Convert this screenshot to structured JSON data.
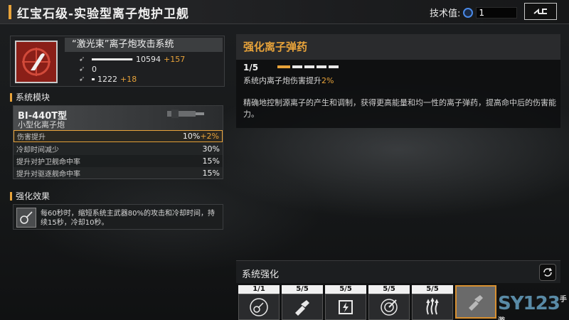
{
  "header": {
    "title": "红宝石级-实验型离子炮护卫舰",
    "tech_label": "技术值:",
    "tech_value": "1"
  },
  "weapon": {
    "name": "“激光束”离子炮攻击系统",
    "stats": [
      {
        "icon": "damage-icon",
        "value": "10594",
        "bonus": "+157",
        "fill": 0.98
      },
      {
        "icon": "rate-icon",
        "value": "0",
        "bonus": "",
        "fill": 0
      },
      {
        "icon": "range-icon",
        "value": "1222",
        "bonus": "+18",
        "fill": 0.05
      }
    ]
  },
  "module": {
    "section_label": "系统模块",
    "code": "BI-440T型",
    "type": "小型化离子炮",
    "rows": [
      {
        "label": "伤害提升",
        "value": "10%",
        "bonus": "+2%",
        "highlight": true
      },
      {
        "label": "冷却时间减少",
        "value": "30%"
      },
      {
        "label": "提升对护卫舰命中率",
        "value": "15%"
      },
      {
        "label": "提升对驱逐舰命中率",
        "value": "15%"
      }
    ]
  },
  "effect": {
    "section_label": "强化效果",
    "text": "每60秒时，缩短系统主武器80%的攻击和冷却时间，持续15秒，冷却10秒。"
  },
  "detail": {
    "title": "强化离子弹药",
    "level": "1/5",
    "level_current": 1,
    "level_max": 5,
    "sub_prefix": "系统内离子炮伤害提升",
    "sub_value": "2%",
    "description": "精确地控制源离子的产生和调制，获得更高能量和均一性的离子弹药，提高命中后的伤害能力。"
  },
  "enhance": {
    "title": "系统强化",
    "slots": [
      {
        "level": "1/1",
        "icon": "guitar-icon",
        "selected": false
      },
      {
        "level": "5/5",
        "icon": "missile-icon",
        "selected": false
      },
      {
        "level": "5/5",
        "icon": "shield-bolt-icon",
        "selected": false
      },
      {
        "level": "5/5",
        "icon": "target-icon",
        "selected": false
      },
      {
        "level": "5/5",
        "icon": "heat-icon",
        "selected": false
      },
      {
        "level": "",
        "icon": "missile-icon",
        "selected": true
      }
    ]
  },
  "watermark": {
    "text": "SY123",
    "sub": "手游"
  },
  "colors": {
    "accent": "#e8a33a",
    "weapon_bg": "#8a1f18"
  }
}
